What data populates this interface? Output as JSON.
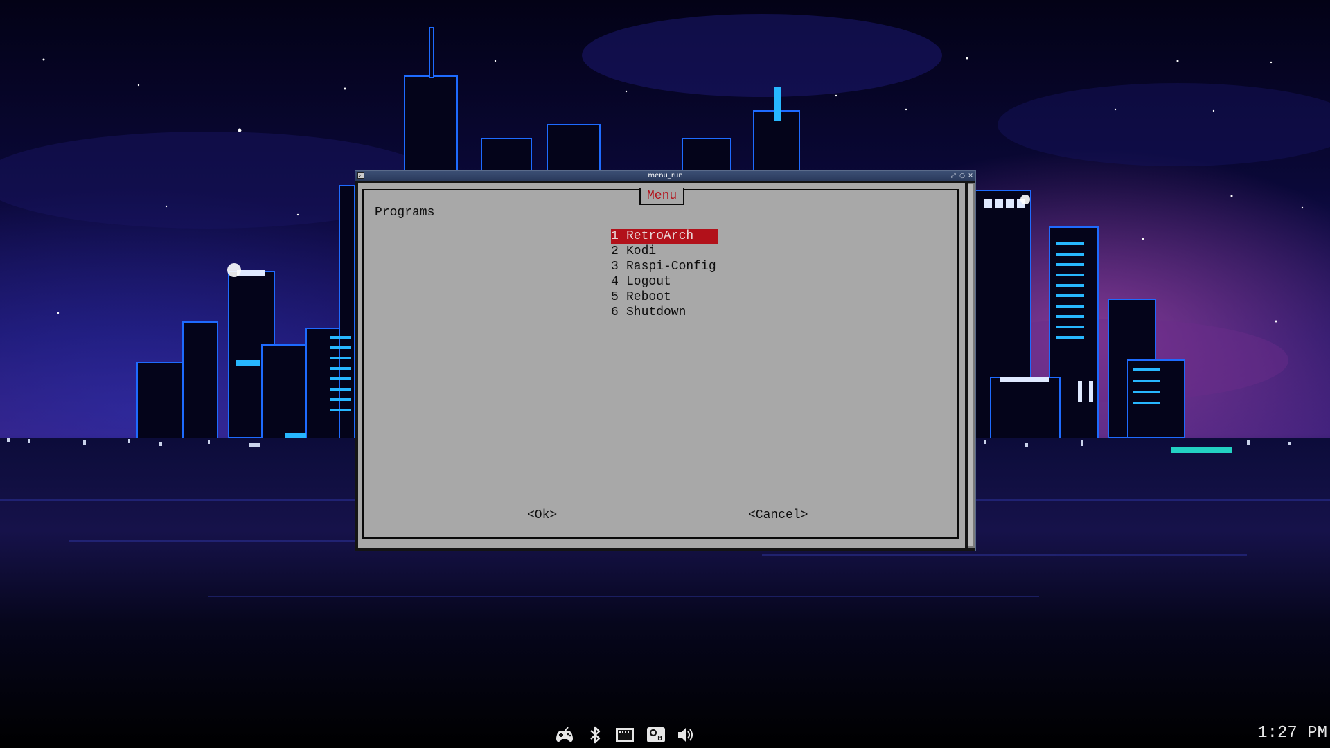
{
  "window": {
    "title": "menu_run"
  },
  "dialog": {
    "title": "Menu",
    "prompt": "Programs",
    "items": [
      {
        "num": "1",
        "label": "RetroArch",
        "selected": true
      },
      {
        "num": "2",
        "label": "Kodi"
      },
      {
        "num": "3",
        "label": "Raspi-Config"
      },
      {
        "num": "4",
        "label": "Logout"
      },
      {
        "num": "5",
        "label": "Reboot"
      },
      {
        "num": "6",
        "label": "Shutdown"
      }
    ],
    "ok_label": "<Ok>",
    "cancel_label": "<Cancel>"
  },
  "taskbar": {
    "icons": [
      "gamepad-icon",
      "bluetooth-icon",
      "network-icon",
      "openbox-icon",
      "volume-icon"
    ],
    "clock": "1:27 PM"
  },
  "colors": {
    "dialog_bg": "#a8a8a8",
    "highlight": "#b2111a",
    "titlebar": "#2f4066"
  }
}
